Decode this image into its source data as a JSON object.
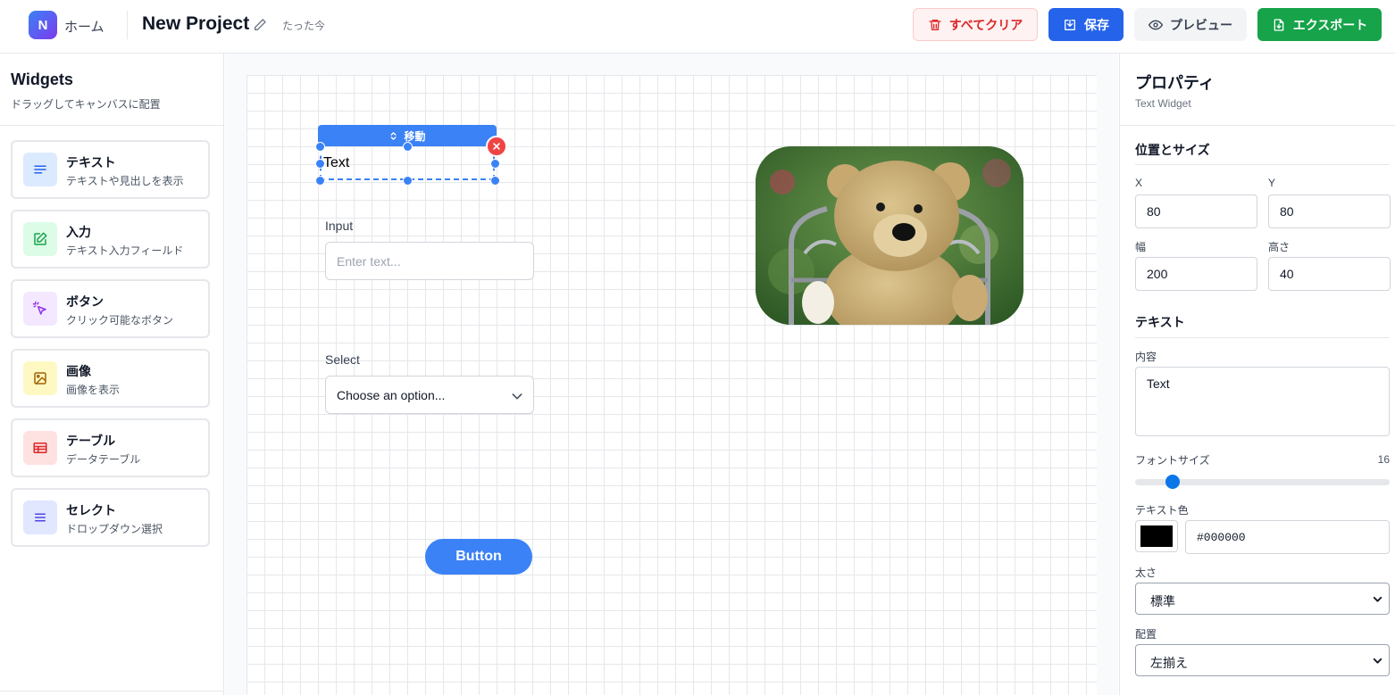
{
  "header": {
    "logo_letter": "N",
    "home_label": "ホーム",
    "project_title": "New Project",
    "saved_status": "たった今",
    "clear_all_label": "すべてクリア",
    "save_label": "保存",
    "preview_label": "プレビュー",
    "export_label": "エクスポート"
  },
  "sidebar": {
    "title": "Widgets",
    "subtitle": "ドラッグしてキャンバスに配置",
    "items": [
      {
        "name": "テキスト",
        "desc": "テキストや見出しを表示",
        "icon": "text-lines-icon",
        "bg": "#dbeafe",
        "fg": "#2563eb"
      },
      {
        "name": "入力",
        "desc": "テキスト入力フィールド",
        "icon": "edit-icon",
        "bg": "#dcfce7",
        "fg": "#16a34a"
      },
      {
        "name": "ボタン",
        "desc": "クリック可能なボタン",
        "icon": "cursor-click-icon",
        "bg": "#f3e8ff",
        "fg": "#9333ea"
      },
      {
        "name": "画像",
        "desc": "画像を表示",
        "icon": "image-icon",
        "bg": "#fef9c3",
        "fg": "#a16207"
      },
      {
        "name": "テーブル",
        "desc": "データテーブル",
        "icon": "table-icon",
        "bg": "#fee2e2",
        "fg": "#dc2626"
      },
      {
        "name": "セレクト",
        "desc": "ドロップダウン選択",
        "icon": "list-icon",
        "bg": "#e0e7ff",
        "fg": "#4f46e5"
      }
    ]
  },
  "canvas": {
    "move_label": "移動",
    "text_widget_text": "Text",
    "input_label": "Input",
    "input_placeholder": "Enter text...",
    "select_label": "Select",
    "select_value": "Choose an option...",
    "button_label": "Button"
  },
  "properties": {
    "title": "プロパティ",
    "subtitle": "Text Widget",
    "position_section": "位置とサイズ",
    "x_label": "X",
    "x_value": "80",
    "y_label": "Y",
    "y_value": "80",
    "width_label": "幅",
    "width_value": "200",
    "height_label": "高さ",
    "height_value": "40",
    "text_section": "テキスト",
    "content_label": "内容",
    "content_value": "Text",
    "font_size_label": "フォントサイズ",
    "font_size_value": "16",
    "text_color_label": "テキスト色",
    "text_color_value": "#000000",
    "weight_label": "太さ",
    "weight_value": "標準",
    "align_label": "配置",
    "align_value": "左揃え"
  },
  "colors": {
    "accent": "#3b82f6",
    "primary": "#2563eb",
    "success": "#16a34a",
    "danger": "#dc2626"
  }
}
